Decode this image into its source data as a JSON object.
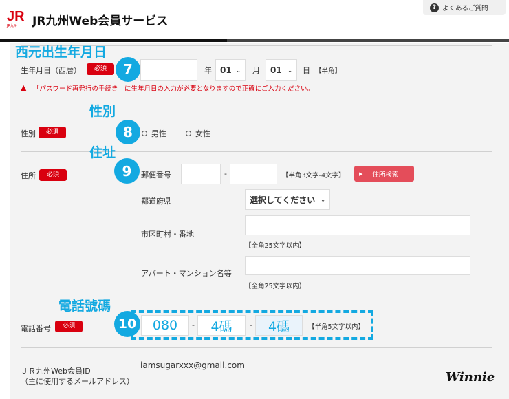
{
  "header": {
    "logo_text": "JR",
    "logo_sub": "JR九州",
    "title": "JR九州Web会員サービス",
    "faq_label": "よくあるご質問"
  },
  "annotations": {
    "birth": "西元出生年月日",
    "gender": "性別",
    "address": "住址",
    "phone": "電話號碼",
    "steps": [
      "7",
      "8",
      "9",
      "10"
    ]
  },
  "required": "必須",
  "birth": {
    "label": "生年月日（西暦）",
    "year_value": "",
    "year_unit": "年",
    "month_value": "01",
    "month_unit": "月",
    "day_value": "01",
    "day_unit": "日",
    "note": "【半角】",
    "warning": "「パスワード再発行の手続き」に生年月日の入力が必要となりますので正確にご入力ください。"
  },
  "gender": {
    "label": "性別",
    "options": [
      "男性",
      "女性"
    ]
  },
  "address": {
    "label": "住所",
    "postal_label": "郵便番号",
    "postal_note": "【半角3文字-4文字】",
    "search_button": "住所検索",
    "dash": "-",
    "pref_label": "都道府県",
    "pref_value": "選択してください",
    "city_label": "市区町村・番地",
    "city_note": "【全角25文字以内】",
    "building_label": "アパート・マンション名等",
    "building_note": "【全角25文字以内】"
  },
  "phone": {
    "label": "電話番号",
    "values": [
      "080",
      "4碼",
      "4碼"
    ],
    "note": "【半角5文字以内】",
    "dash": "-"
  },
  "member": {
    "label1": "ＪＲ九州Web会員ID",
    "label2": "（主に使用するメールアドレス）",
    "email": "iamsugarxxx@gmail.com"
  },
  "signature": "Winnie"
}
